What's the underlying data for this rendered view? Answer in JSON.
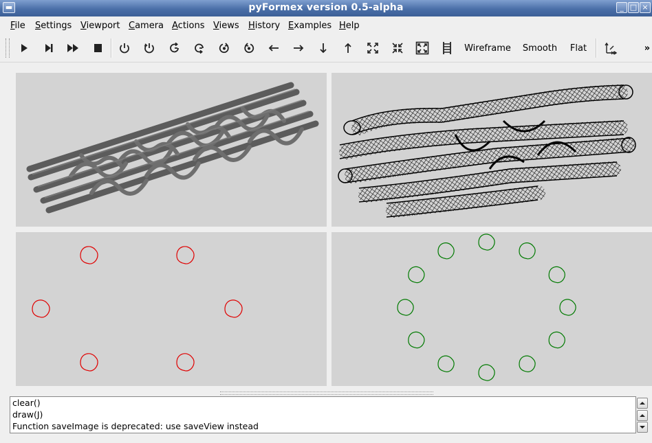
{
  "window": {
    "title": "pyFormex version 0.5-alpha"
  },
  "menu": [
    {
      "label": "File",
      "u": "F",
      "rest": "ile"
    },
    {
      "label": "Settings",
      "u": "S",
      "rest": "ettings"
    },
    {
      "label": "Viewport",
      "u": "V",
      "rest": "iewport"
    },
    {
      "label": "Camera",
      "u": "C",
      "rest": "amera"
    },
    {
      "label": "Actions",
      "u": "A",
      "rest": "ctions"
    },
    {
      "label": "Views",
      "u": "V",
      "rest": "iews"
    },
    {
      "label": "History",
      "u": "H",
      "rest": "istory"
    },
    {
      "label": "Examples",
      "u": "E",
      "rest": "xamples"
    },
    {
      "label": "Help",
      "u": "H",
      "rest": "elp"
    }
  ],
  "toolbar": {
    "icons": [
      "play-icon",
      "step-icon",
      "continue-icon",
      "stop-icon",
      "rotate-left-icon",
      "rotate-right-icon",
      "rotate-up-icon",
      "rotate-down-icon",
      "rotate-ccw-icon",
      "rotate-cw-icon",
      "pan-left-icon",
      "pan-right-icon",
      "pan-down-icon",
      "pan-up-icon",
      "zoom-in-icon",
      "zoom-out-icon",
      "zoom-all-icon",
      "frame-icon",
      "reset-view-icon"
    ],
    "wireframe_label": "Wireframe",
    "smooth_label": "Smooth",
    "flat_label": "Flat",
    "overflow_label": "»"
  },
  "viewports": [
    {
      "name": "smooth-stent-viewport",
      "color": "#5f5f5f"
    },
    {
      "name": "wireframe-stent-viewport",
      "color": "#000000"
    },
    {
      "name": "red-cross-section-viewport",
      "color": "#e00000",
      "count": 6
    },
    {
      "name": "green-cross-section-viewport",
      "color": "#007a00",
      "count": 12
    }
  ],
  "console": {
    "lines": [
      "clear()",
      "draw(J)",
      "Function saveImage is deprecated: use saveView instead"
    ]
  }
}
